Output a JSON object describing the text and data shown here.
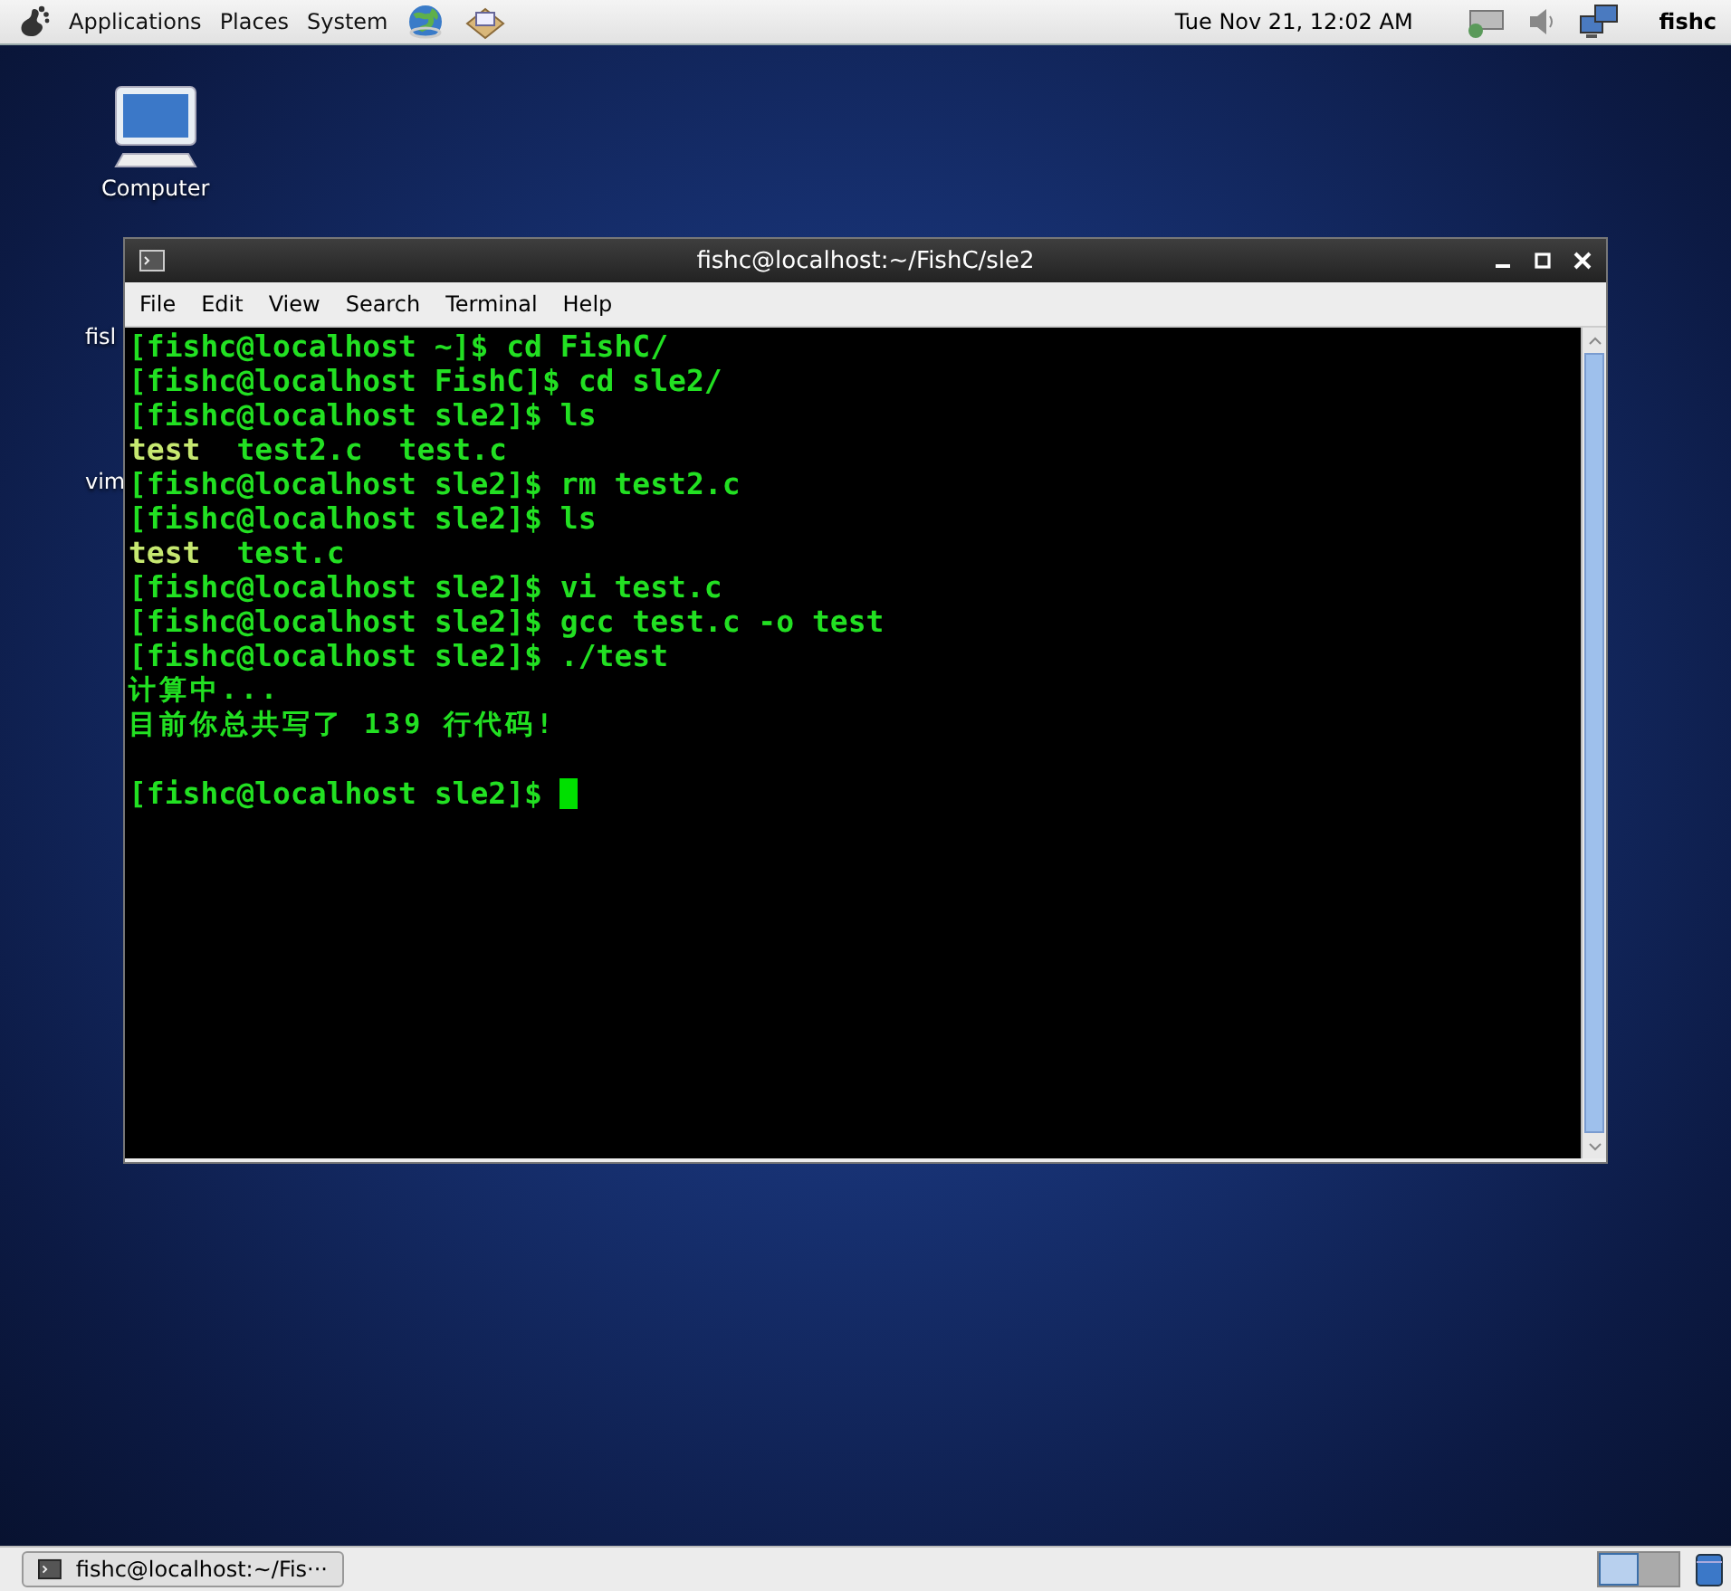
{
  "top_panel": {
    "menus": [
      "Applications",
      "Places",
      "System"
    ],
    "clock": "Tue Nov 21, 12:02 AM",
    "user": "fishc"
  },
  "desktop_icons": [
    {
      "label": "Computer",
      "kind": "computer"
    },
    {
      "label": "fisl",
      "kind": "hidden"
    },
    {
      "label": "vim",
      "kind": "hidden"
    }
  ],
  "terminal": {
    "title": "fishc@localhost:~/FishC/sle2",
    "menus": [
      "File",
      "Edit",
      "View",
      "Search",
      "Terminal",
      "Help"
    ],
    "lines": [
      [
        {
          "text": "[fishc@localhost ~]$ cd FishC/",
          "kind": "plain"
        }
      ],
      [
        {
          "text": "[fishc@localhost FishC]$ cd sle2/",
          "kind": "plain"
        }
      ],
      [
        {
          "text": "[fishc@localhost sle2]$ ls",
          "kind": "plain"
        }
      ],
      [
        {
          "text": "test",
          "kind": "executable"
        },
        {
          "text": "test2.c",
          "kind": "plain"
        },
        {
          "text": "test.c",
          "kind": "plain"
        }
      ],
      [
        {
          "text": "[fishc@localhost sle2]$ rm test2.c",
          "kind": "plain"
        }
      ],
      [
        {
          "text": "[fishc@localhost sle2]$ ls",
          "kind": "plain"
        }
      ],
      [
        {
          "text": "test",
          "kind": "executable"
        },
        {
          "text": "test.c",
          "kind": "plain"
        }
      ],
      [
        {
          "text": "[fishc@localhost sle2]$ vi test.c",
          "kind": "plain"
        }
      ],
      [
        {
          "text": "[fishc@localhost sle2]$ gcc test.c -o test",
          "kind": "plain"
        }
      ],
      [
        {
          "text": "[fishc@localhost sle2]$ ./test",
          "kind": "plain"
        }
      ],
      [
        {
          "text": "计算中...",
          "kind": "cjk"
        }
      ],
      [
        {
          "text": "目前你总共写了 139 行代码!",
          "kind": "cjk"
        }
      ],
      {
        "kind": "blank"
      },
      [
        {
          "text": "[fishc@localhost sle2]$",
          "kind": "plain"
        }
      ]
    ],
    "cursor": true
  },
  "bottom_panel": {
    "tasks": [
      {
        "label": "fishc@localhost:~/Fis···",
        "selected": false
      }
    ],
    "workspaces": [
      {
        "selected": true
      },
      {
        "selected": false
      }
    ]
  }
}
